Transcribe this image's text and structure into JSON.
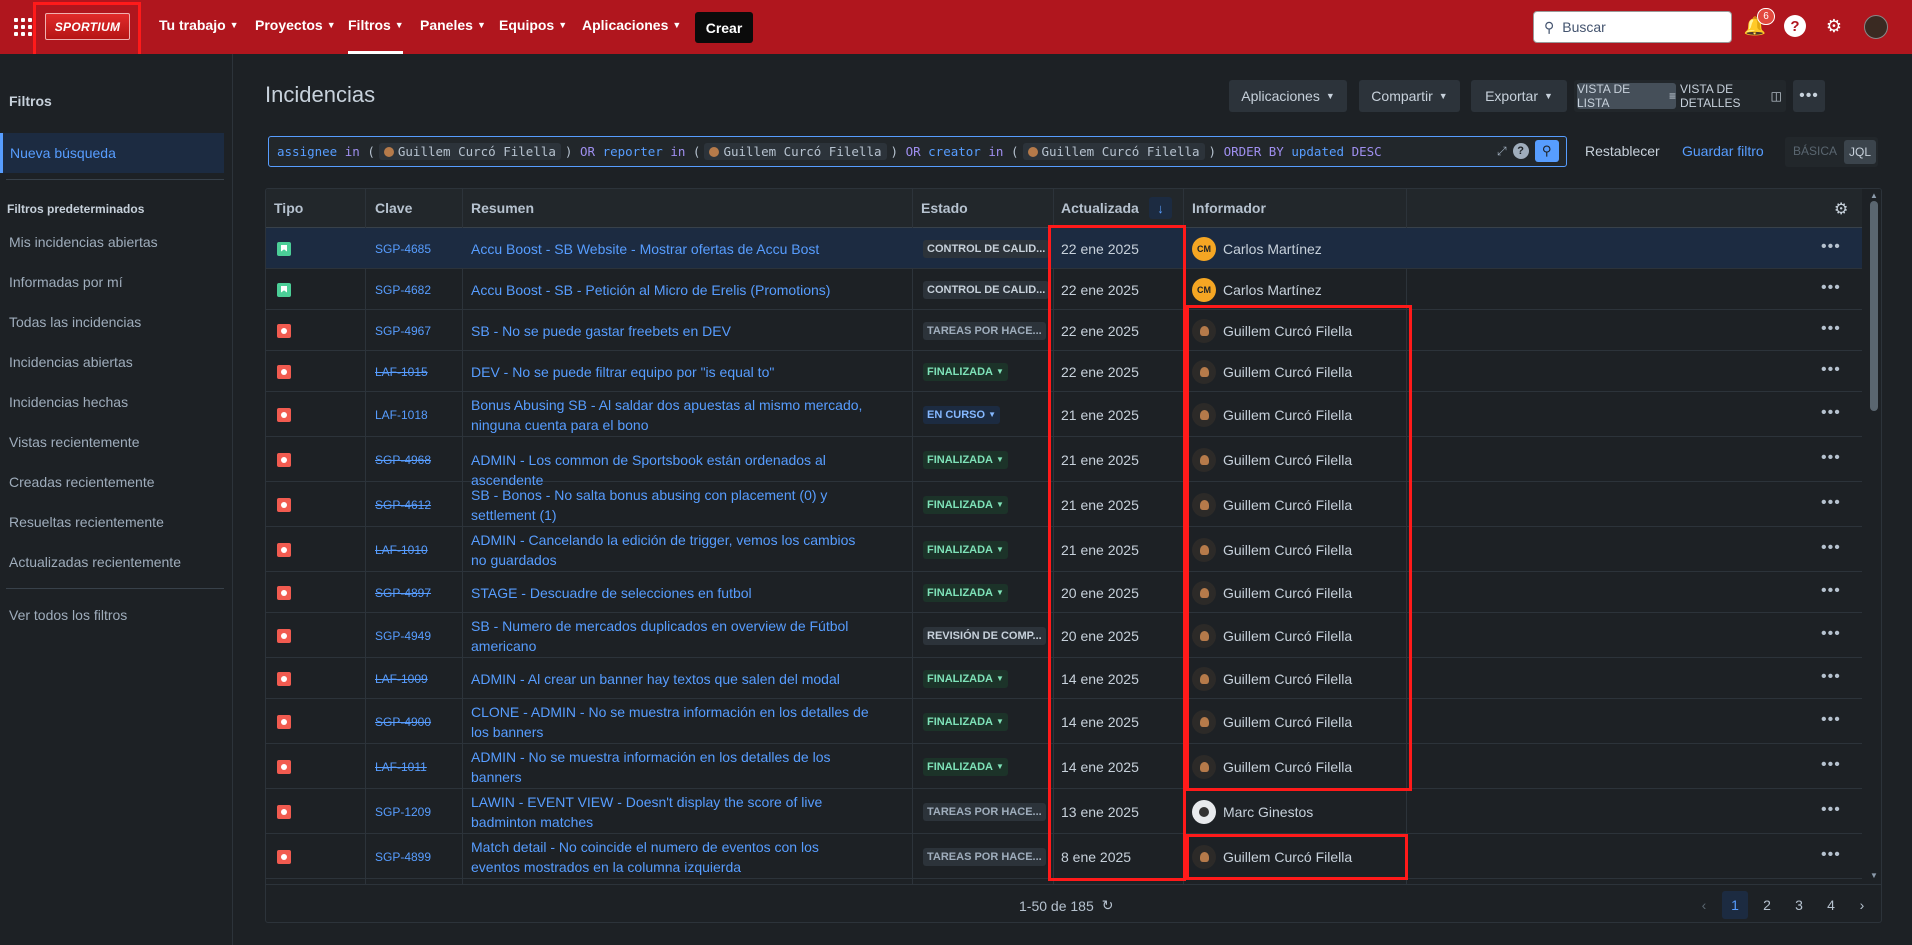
{
  "topnav": {
    "logo_text": "SPORTIUM",
    "items": [
      {
        "label": "Tu trabajo"
      },
      {
        "label": "Proyectos"
      },
      {
        "label": "Filtros"
      },
      {
        "label": "Paneles"
      },
      {
        "label": "Equipos"
      },
      {
        "label": "Aplicaciones"
      }
    ],
    "create_label": "Crear",
    "search_placeholder": "Buscar",
    "notifications_count": "6",
    "help_label": "?"
  },
  "sidebar": {
    "title": "Filtros",
    "new_search": "Nueva búsqueda",
    "default_heading": "Filtros predeterminados",
    "items": [
      "Mis incidencias abiertas",
      "Informadas por mí",
      "Todas las incidencias",
      "Incidencias abiertas",
      "Incidencias hechas",
      "Vistas recientemente",
      "Creadas recientemente",
      "Resueltas recientemente",
      "Actualizadas recientemente"
    ],
    "all_filters": "Ver todos los filtros"
  },
  "main": {
    "title": "Incidencias",
    "toolbar": {
      "apps": "Aplicaciones",
      "share": "Compartir",
      "export": "Exportar",
      "list_view": "VISTA DE LISTA",
      "detail_view": "VISTA DE DETALLES"
    },
    "jql": {
      "p1": "assignee",
      "p2": "in",
      "p3": "(",
      "user": "Guillem Curcó Filella",
      "p4": ")",
      "p5": "OR",
      "p6": "reporter",
      "p7": "creator",
      "p8": "ORDER BY",
      "p9": "updated",
      "p10": "DESC"
    },
    "reset": "Restablecer",
    "save_filter": "Guardar filtro",
    "mode_basic": "BÁSICA",
    "mode_jql": "JQL"
  },
  "table": {
    "headers": {
      "type": "Tipo",
      "key": "Clave",
      "summary": "Resumen",
      "status": "Estado",
      "updated": "Actualizada",
      "reporter": "Informador"
    },
    "rows": [
      {
        "type": "story",
        "key": "SGP-4685",
        "done": false,
        "summary": "Accu Boost - SB Website - Mostrar ofertas de Accu Bost",
        "status": "CONTROL DE CALID...",
        "status_kind": "qa",
        "updated": "22 ene 2025",
        "reporter": "Carlos Martínez",
        "reporter_initials": "CM",
        "av": "cm"
      },
      {
        "type": "story",
        "key": "SGP-4682",
        "done": false,
        "summary": "Accu Boost - SB - Petición al Micro de Erelis (Promotions)",
        "status": "CONTROL DE CALID...",
        "status_kind": "qa",
        "updated": "22 ene 2025",
        "reporter": "Carlos Martínez",
        "reporter_initials": "CM",
        "av": "cm"
      },
      {
        "type": "bug",
        "key": "SGP-4967",
        "done": false,
        "summary": "SB - No se puede gastar freebets en DEV",
        "status": "TAREAS POR HACE...",
        "status_kind": "todo",
        "updated": "22 ene 2025",
        "reporter": "Guillem Curcó Filella",
        "reporter_initials": "",
        "av": "gc"
      },
      {
        "type": "bug",
        "key": "LAF-1015",
        "done": true,
        "summary": "DEV - No se puede filtrar equipo por \"is equal to\"",
        "status": "FINALIZADA",
        "status_kind": "done",
        "updated": "22 ene 2025",
        "reporter": "Guillem Curcó Filella",
        "reporter_initials": "",
        "av": "gc"
      },
      {
        "type": "bug",
        "key": "LAF-1018",
        "done": false,
        "summary": "Bonus Abusing SB - Al saldar dos apuestas al mismo mercado, ninguna cuenta para el bono",
        "status": "EN CURSO",
        "status_kind": "prog",
        "updated": "21 ene 2025",
        "reporter": "Guillem Curcó Filella",
        "reporter_initials": "",
        "av": "gc"
      },
      {
        "type": "bug",
        "key": "SGP-4968",
        "done": true,
        "summary": "ADMIN - Los common de Sportsbook están ordenados al ascendente",
        "status": "FINALIZADA",
        "status_kind": "done",
        "updated": "21 ene 2025",
        "reporter": "Guillem Curcó Filella",
        "reporter_initials": "",
        "av": "gc"
      },
      {
        "type": "bug",
        "key": "SGP-4612",
        "done": true,
        "summary": "SB - Bonos - No salta bonus abusing con placement (0) y settlement (1)",
        "status": "FINALIZADA",
        "status_kind": "done",
        "updated": "21 ene 2025",
        "reporter": "Guillem Curcó Filella",
        "reporter_initials": "",
        "av": "gc"
      },
      {
        "type": "bug",
        "key": "LAF-1010",
        "done": true,
        "summary": "ADMIN - Cancelando la edición de trigger, vemos los cambios no guardados",
        "status": "FINALIZADA",
        "status_kind": "done",
        "updated": "21 ene 2025",
        "reporter": "Guillem Curcó Filella",
        "reporter_initials": "",
        "av": "gc"
      },
      {
        "type": "bug",
        "key": "SGP-4897",
        "done": true,
        "summary": "STAGE - Descuadre de selecciones en futbol",
        "status": "FINALIZADA",
        "status_kind": "done",
        "updated": "20 ene 2025",
        "reporter": "Guillem Curcó Filella",
        "reporter_initials": "",
        "av": "gc"
      },
      {
        "type": "bug",
        "key": "SGP-4949",
        "done": false,
        "summary": "SB - Numero de mercados duplicados en overview de Fútbol americano",
        "status": "REVISIÓN DE COMP...",
        "status_kind": "review",
        "updated": "20 ene 2025",
        "reporter": "Guillem Curcó Filella",
        "reporter_initials": "",
        "av": "gc"
      },
      {
        "type": "bug",
        "key": "LAF-1009",
        "done": true,
        "summary": "ADMIN - Al crear un banner hay textos que salen del modal",
        "status": "FINALIZADA",
        "status_kind": "done",
        "updated": "14 ene 2025",
        "reporter": "Guillem Curcó Filella",
        "reporter_initials": "",
        "av": "gc"
      },
      {
        "type": "bug",
        "key": "SGP-4900",
        "done": true,
        "summary": "CLONE - ADMIN - No se muestra información en los detalles de los banners",
        "status": "FINALIZADA",
        "status_kind": "done",
        "updated": "14 ene 2025",
        "reporter": "Guillem Curcó Filella",
        "reporter_initials": "",
        "av": "gc"
      },
      {
        "type": "bug",
        "key": "LAF-1011",
        "done": true,
        "summary": "ADMIN - No se muestra información en los detalles de los banners",
        "status": "FINALIZADA",
        "status_kind": "done",
        "updated": "14 ene 2025",
        "reporter": "Guillem Curcó Filella",
        "reporter_initials": "",
        "av": "gc"
      },
      {
        "type": "bug",
        "key": "SGP-1209",
        "done": false,
        "summary": "LAWIN - EVENT VIEW - Doesn't display the score of live badminton matches",
        "status": "TAREAS POR HACE...",
        "status_kind": "todo",
        "updated": "13 ene 2025",
        "reporter": "Marc Ginestos",
        "reporter_initials": "",
        "av": "mg"
      },
      {
        "type": "bug",
        "key": "SGP-4899",
        "done": false,
        "summary": "Match detail - No coincide el numero de eventos con los eventos mostrados en la columna izquierda",
        "status": "TAREAS POR HACE...",
        "status_kind": "todo",
        "updated": "8 ene 2025",
        "reporter": "Guillem Curcó Filella",
        "reporter_initials": "",
        "av": "gc"
      }
    ],
    "pagination": {
      "range": "1-50 de 185",
      "pages": [
        "1",
        "2",
        "3",
        "4"
      ]
    }
  }
}
